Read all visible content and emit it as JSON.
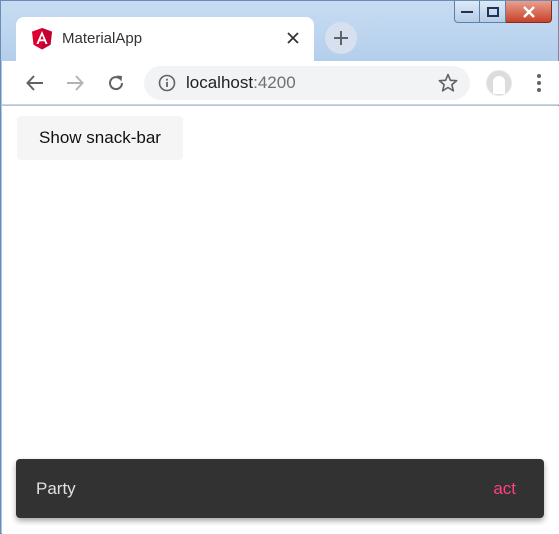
{
  "browser": {
    "tab": {
      "title": "MaterialApp",
      "favicon": "angular-logo-icon"
    },
    "address": {
      "host": "localhost",
      "port": ":4200"
    },
    "colors": {
      "frame": "#a9c7e8",
      "close_button": "#c7422a"
    }
  },
  "page": {
    "button_label": "Show snack-bar"
  },
  "snackbar": {
    "message": "Party",
    "action": "act",
    "background": "#323232",
    "action_color": "#ff4081"
  }
}
